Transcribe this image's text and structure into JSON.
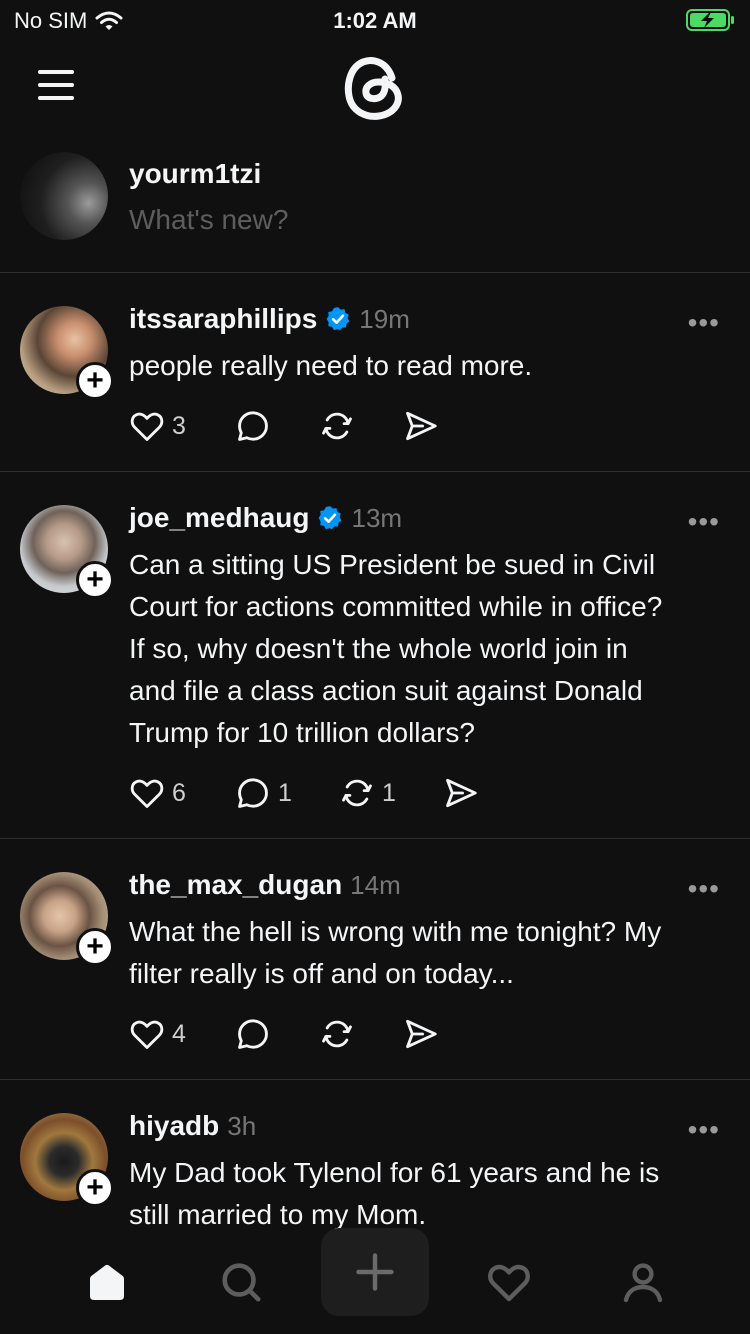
{
  "status": {
    "carrier": "No SIM",
    "time": "1:02 AM"
  },
  "composer": {
    "username": "yourm1tzi",
    "placeholder": "What's new?"
  },
  "posts": [
    {
      "username": "itssaraphillips",
      "verified": true,
      "time": "19m",
      "lines": [
        "people really need to read more."
      ],
      "likes": "3",
      "replies": "",
      "reposts": ""
    },
    {
      "username": "joe_medhaug",
      "verified": true,
      "time": "13m",
      "lines": [
        "Can a sitting US President be sued in Civil",
        "Court for actions committed while in office?",
        "If so, why doesn't the whole world join in",
        "and file a class action suit against Donald",
        "Trump for 10 trillion dollars?"
      ],
      "likes": "6",
      "replies": "1",
      "reposts": "1"
    },
    {
      "username": "the_max_dugan",
      "verified": false,
      "time": "14m",
      "lines": [
        "What the hell is wrong with me tonight? My",
        "filter really is off and on today..."
      ],
      "likes": "4",
      "replies": "",
      "reposts": ""
    },
    {
      "username": "hiyadb",
      "verified": false,
      "time": "3h",
      "lines": [
        "My Dad took Tylenol for 61 years and he is",
        "still married to my Mom."
      ],
      "likes": "",
      "replies": "",
      "reposts": ""
    }
  ],
  "icons": {
    "more": "more-horizontal-icon",
    "like": "heart-icon",
    "reply": "comment-icon",
    "repost": "repost-icon",
    "share": "send-icon",
    "follow": "plus-icon"
  },
  "colors": {
    "background": "#101010",
    "text": "#f3f5f7",
    "muted": "#777777",
    "verified": "#0095f6",
    "divider": "#2d2d2d"
  }
}
